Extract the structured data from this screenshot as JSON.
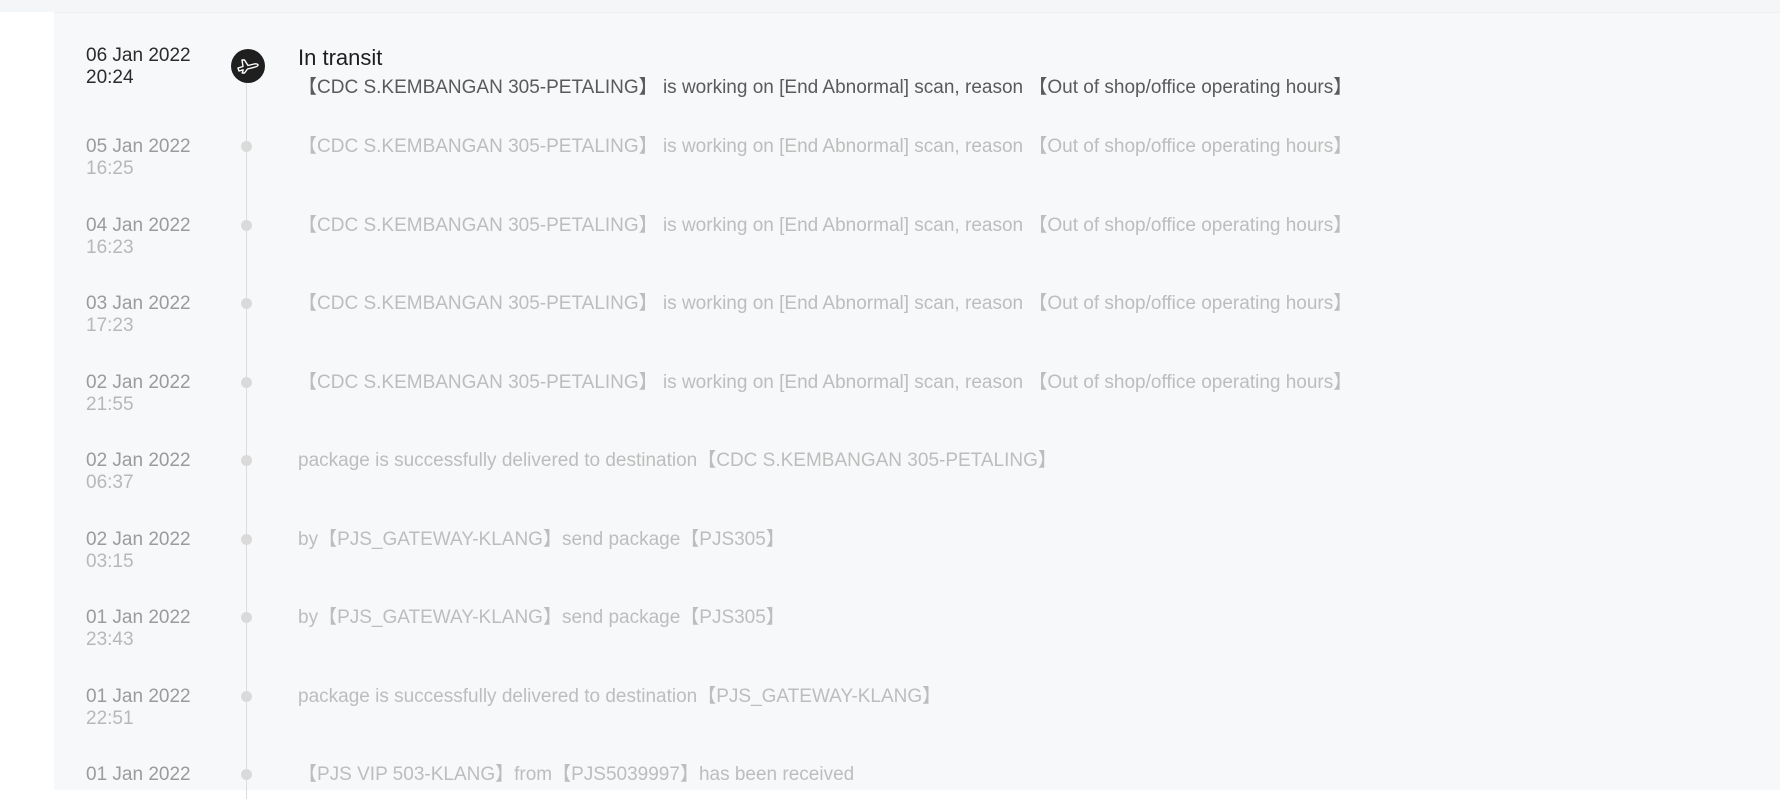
{
  "tracking": {
    "current_status": "In transit",
    "current_icon": "airplane-icon",
    "events": [
      {
        "date": "06 Jan 2022",
        "time": "20:24",
        "description": "【CDC S.KEMBANGAN 305-PETALING】 is working on [End Abnormal] scan, reason 【Out of shop/office operating hours】"
      },
      {
        "date": "05 Jan 2022",
        "time": "16:25",
        "description": "【CDC S.KEMBANGAN 305-PETALING】 is working on [End Abnormal] scan, reason 【Out of shop/office operating hours】"
      },
      {
        "date": "04 Jan 2022",
        "time": "16:23",
        "description": "【CDC S.KEMBANGAN 305-PETALING】 is working on [End Abnormal] scan, reason 【Out of shop/office operating hours】"
      },
      {
        "date": "03 Jan 2022",
        "time": "17:23",
        "description": "【CDC S.KEMBANGAN 305-PETALING】 is working on [End Abnormal] scan, reason 【Out of shop/office operating hours】"
      },
      {
        "date": "02 Jan 2022",
        "time": "21:55",
        "description": "【CDC S.KEMBANGAN 305-PETALING】 is working on [End Abnormal] scan, reason 【Out of shop/office operating hours】"
      },
      {
        "date": "02 Jan 2022",
        "time": "06:37",
        "description": "package is successfully delivered to destination【CDC S.KEMBANGAN 305-PETALING】"
      },
      {
        "date": "02 Jan 2022",
        "time": "03:15",
        "description": "by【PJS_GATEWAY-KLANG】send package【PJS305】"
      },
      {
        "date": "01 Jan 2022",
        "time": "23:43",
        "description": "by【PJS_GATEWAY-KLANG】send package【PJS305】"
      },
      {
        "date": "01 Jan 2022",
        "time": "22:51",
        "description": "package is successfully delivered to destination【PJS_GATEWAY-KLANG】"
      },
      {
        "date": "01 Jan 2022",
        "time": "",
        "description": "【PJS VIP 503-KLANG】from【PJS5039997】has been received"
      }
    ]
  }
}
